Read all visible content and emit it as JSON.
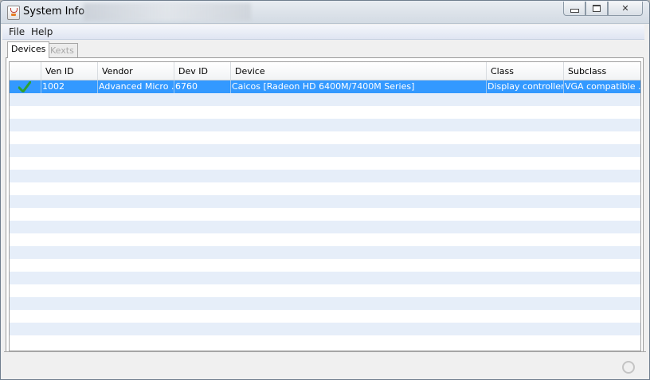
{
  "window": {
    "title": "System Info"
  },
  "menu": {
    "file": "File",
    "help": "Help"
  },
  "tabs": [
    {
      "label": "Devices",
      "active": true
    },
    {
      "label": "Kexts",
      "enabled": false
    }
  ],
  "table": {
    "columns": [
      "",
      "Ven ID",
      "Vendor",
      "Dev ID",
      "Device",
      "Class",
      "Subclass"
    ],
    "rows": [
      {
        "ok": true,
        "ven_id": "1002",
        "vendor": "Advanced Micro ...",
        "dev_id": "6760",
        "device": "Caicos [Radeon HD 6400M/7400M Series]",
        "class": "Display controller",
        "subclass": "VGA compatible ..."
      }
    ]
  },
  "colors": {
    "selection": "#3399ff",
    "stripe": "#e6eef9",
    "check": "#2fa12f"
  },
  "icons": {
    "check": "check-icon",
    "status": "spinner-icon",
    "app": "java-app-icon"
  }
}
